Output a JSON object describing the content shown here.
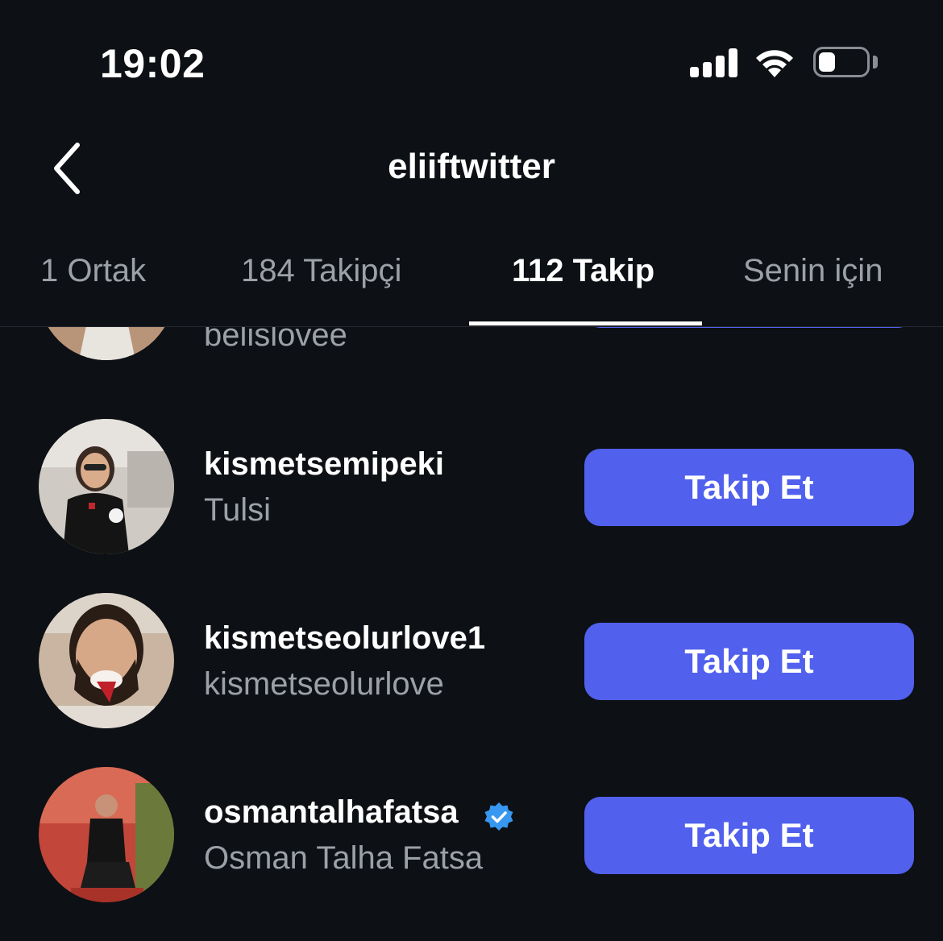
{
  "status_bar": {
    "time": "19:02",
    "battery_level": 0.35
  },
  "header": {
    "title": "eliiftwitter",
    "back_icon": "chevron-left-icon"
  },
  "tabs": [
    {
      "label": "1 Ortak",
      "active": false
    },
    {
      "label": "184 Takipçi",
      "active": false
    },
    {
      "label": "112 Takip",
      "active": true
    },
    {
      "label": "Senin için",
      "active": false
    }
  ],
  "following": [
    {
      "username": "",
      "fullname": "belislovee",
      "verified": false,
      "button": ""
    },
    {
      "username": "kismetsemipeki",
      "fullname": "Tulsi",
      "verified": false,
      "button": "Takip Et"
    },
    {
      "username": "kismetseolurlove1",
      "fullname": "kismetseolurlove",
      "verified": false,
      "button": "Takip Et"
    },
    {
      "username": "osmantalhafatsa",
      "fullname": "Osman Talha Fatsa",
      "verified": true,
      "button": "Takip Et"
    }
  ],
  "colors": {
    "background": "#0d1014",
    "accent": "#5160ed",
    "muted_text": "#9ca0a7",
    "verified": "#3897f0"
  }
}
